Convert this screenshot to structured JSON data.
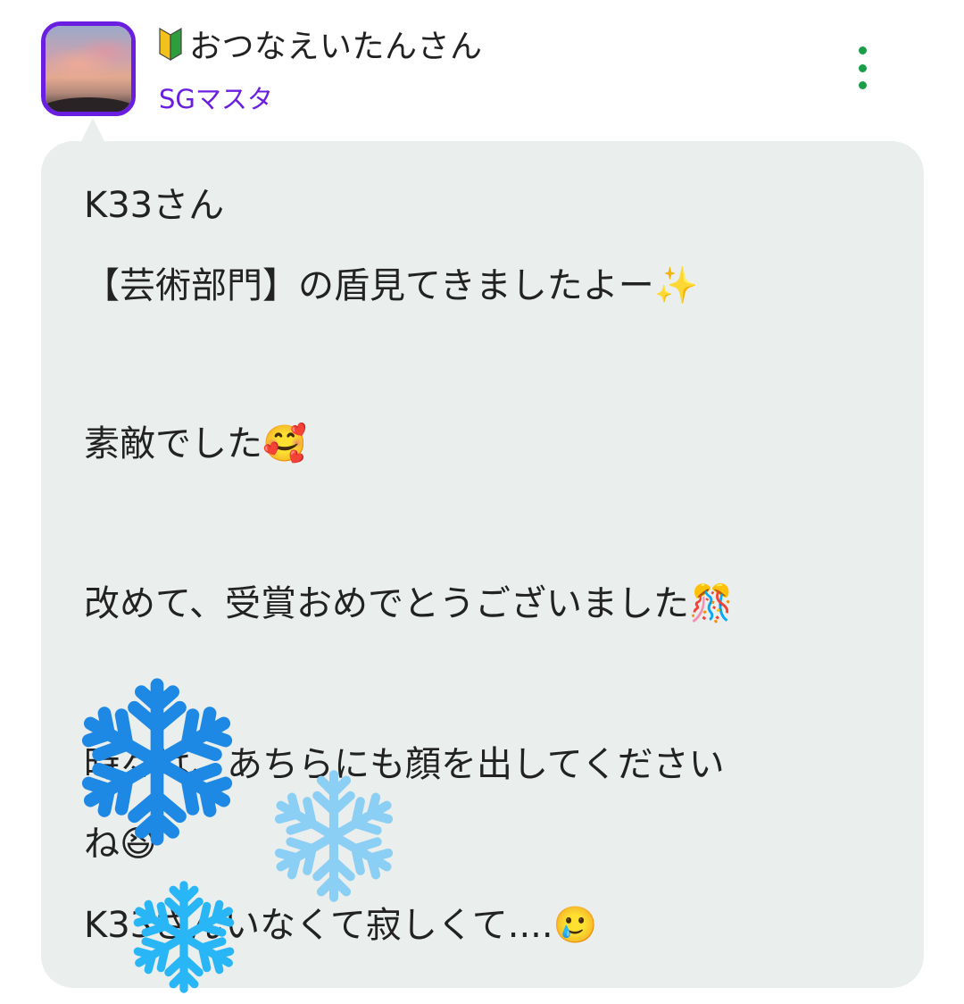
{
  "post": {
    "author": {
      "beginner_badge_icon": "beginner-mark-icon",
      "name": "おつなえいたんさん",
      "rank": "SGマスタ"
    },
    "menu_icon": "more-vertical-icon",
    "message": {
      "lines": [
        "K33さん",
        "【芸術部門】の盾見てきましたよー✨",
        "素敵でした🥰",
        "改めて、受賞おめでとうございました🎊",
        "時々は、あちらにも顔を出してください",
        "ね😆",
        "K33さんいなくて寂しくて....🥲"
      ]
    },
    "decorations": [
      "snowflake-icon",
      "snowflake-icon",
      "snowflake-icon"
    ],
    "colors": {
      "accent": "#6a1fe0",
      "menu": "#1a9e4a",
      "bubble": "#eaeeed",
      "snowflake_dark": "#1e88e5",
      "snowflake_light": "#8ccff5",
      "snowflake_cyan": "#29b6f6"
    }
  }
}
